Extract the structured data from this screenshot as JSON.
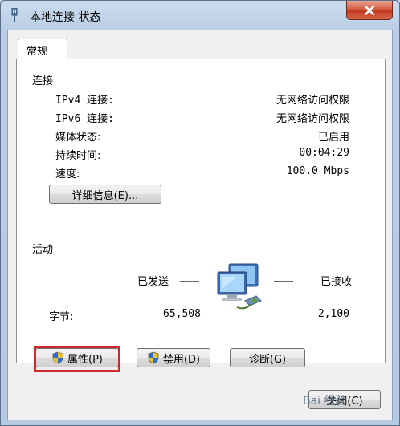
{
  "window": {
    "title": "本地连接 状态"
  },
  "tabs": [
    {
      "label": "常规"
    }
  ],
  "connection": {
    "group_label": "连接",
    "rows": [
      {
        "label": "IPv4 连接:",
        "value": "无网络访问权限"
      },
      {
        "label": "IPv6 连接:",
        "value": "无网络访问权限"
      },
      {
        "label": "媒体状态:",
        "value": "已启用"
      },
      {
        "label": "持续时间:",
        "value": "00:04:29"
      },
      {
        "label": "速度:",
        "value": "100.0 Mbps"
      }
    ],
    "details_button": "详细信息(E)..."
  },
  "activity": {
    "group_label": "活动",
    "sent_label": "已发送",
    "received_label": "已接收",
    "bytes_label": "字节:",
    "bytes_sent": "65,508",
    "bytes_received": "2,100"
  },
  "buttons": {
    "properties": "属性(P)",
    "disable": "禁用(D)",
    "diagnose": "诊断(G)",
    "close": "关闭(C)"
  },
  "watermark": "Bai 经验",
  "colors": {
    "highlight": "#cc2a2e",
    "titlebar": "#c9dcef",
    "close_button": "#c1361d"
  }
}
